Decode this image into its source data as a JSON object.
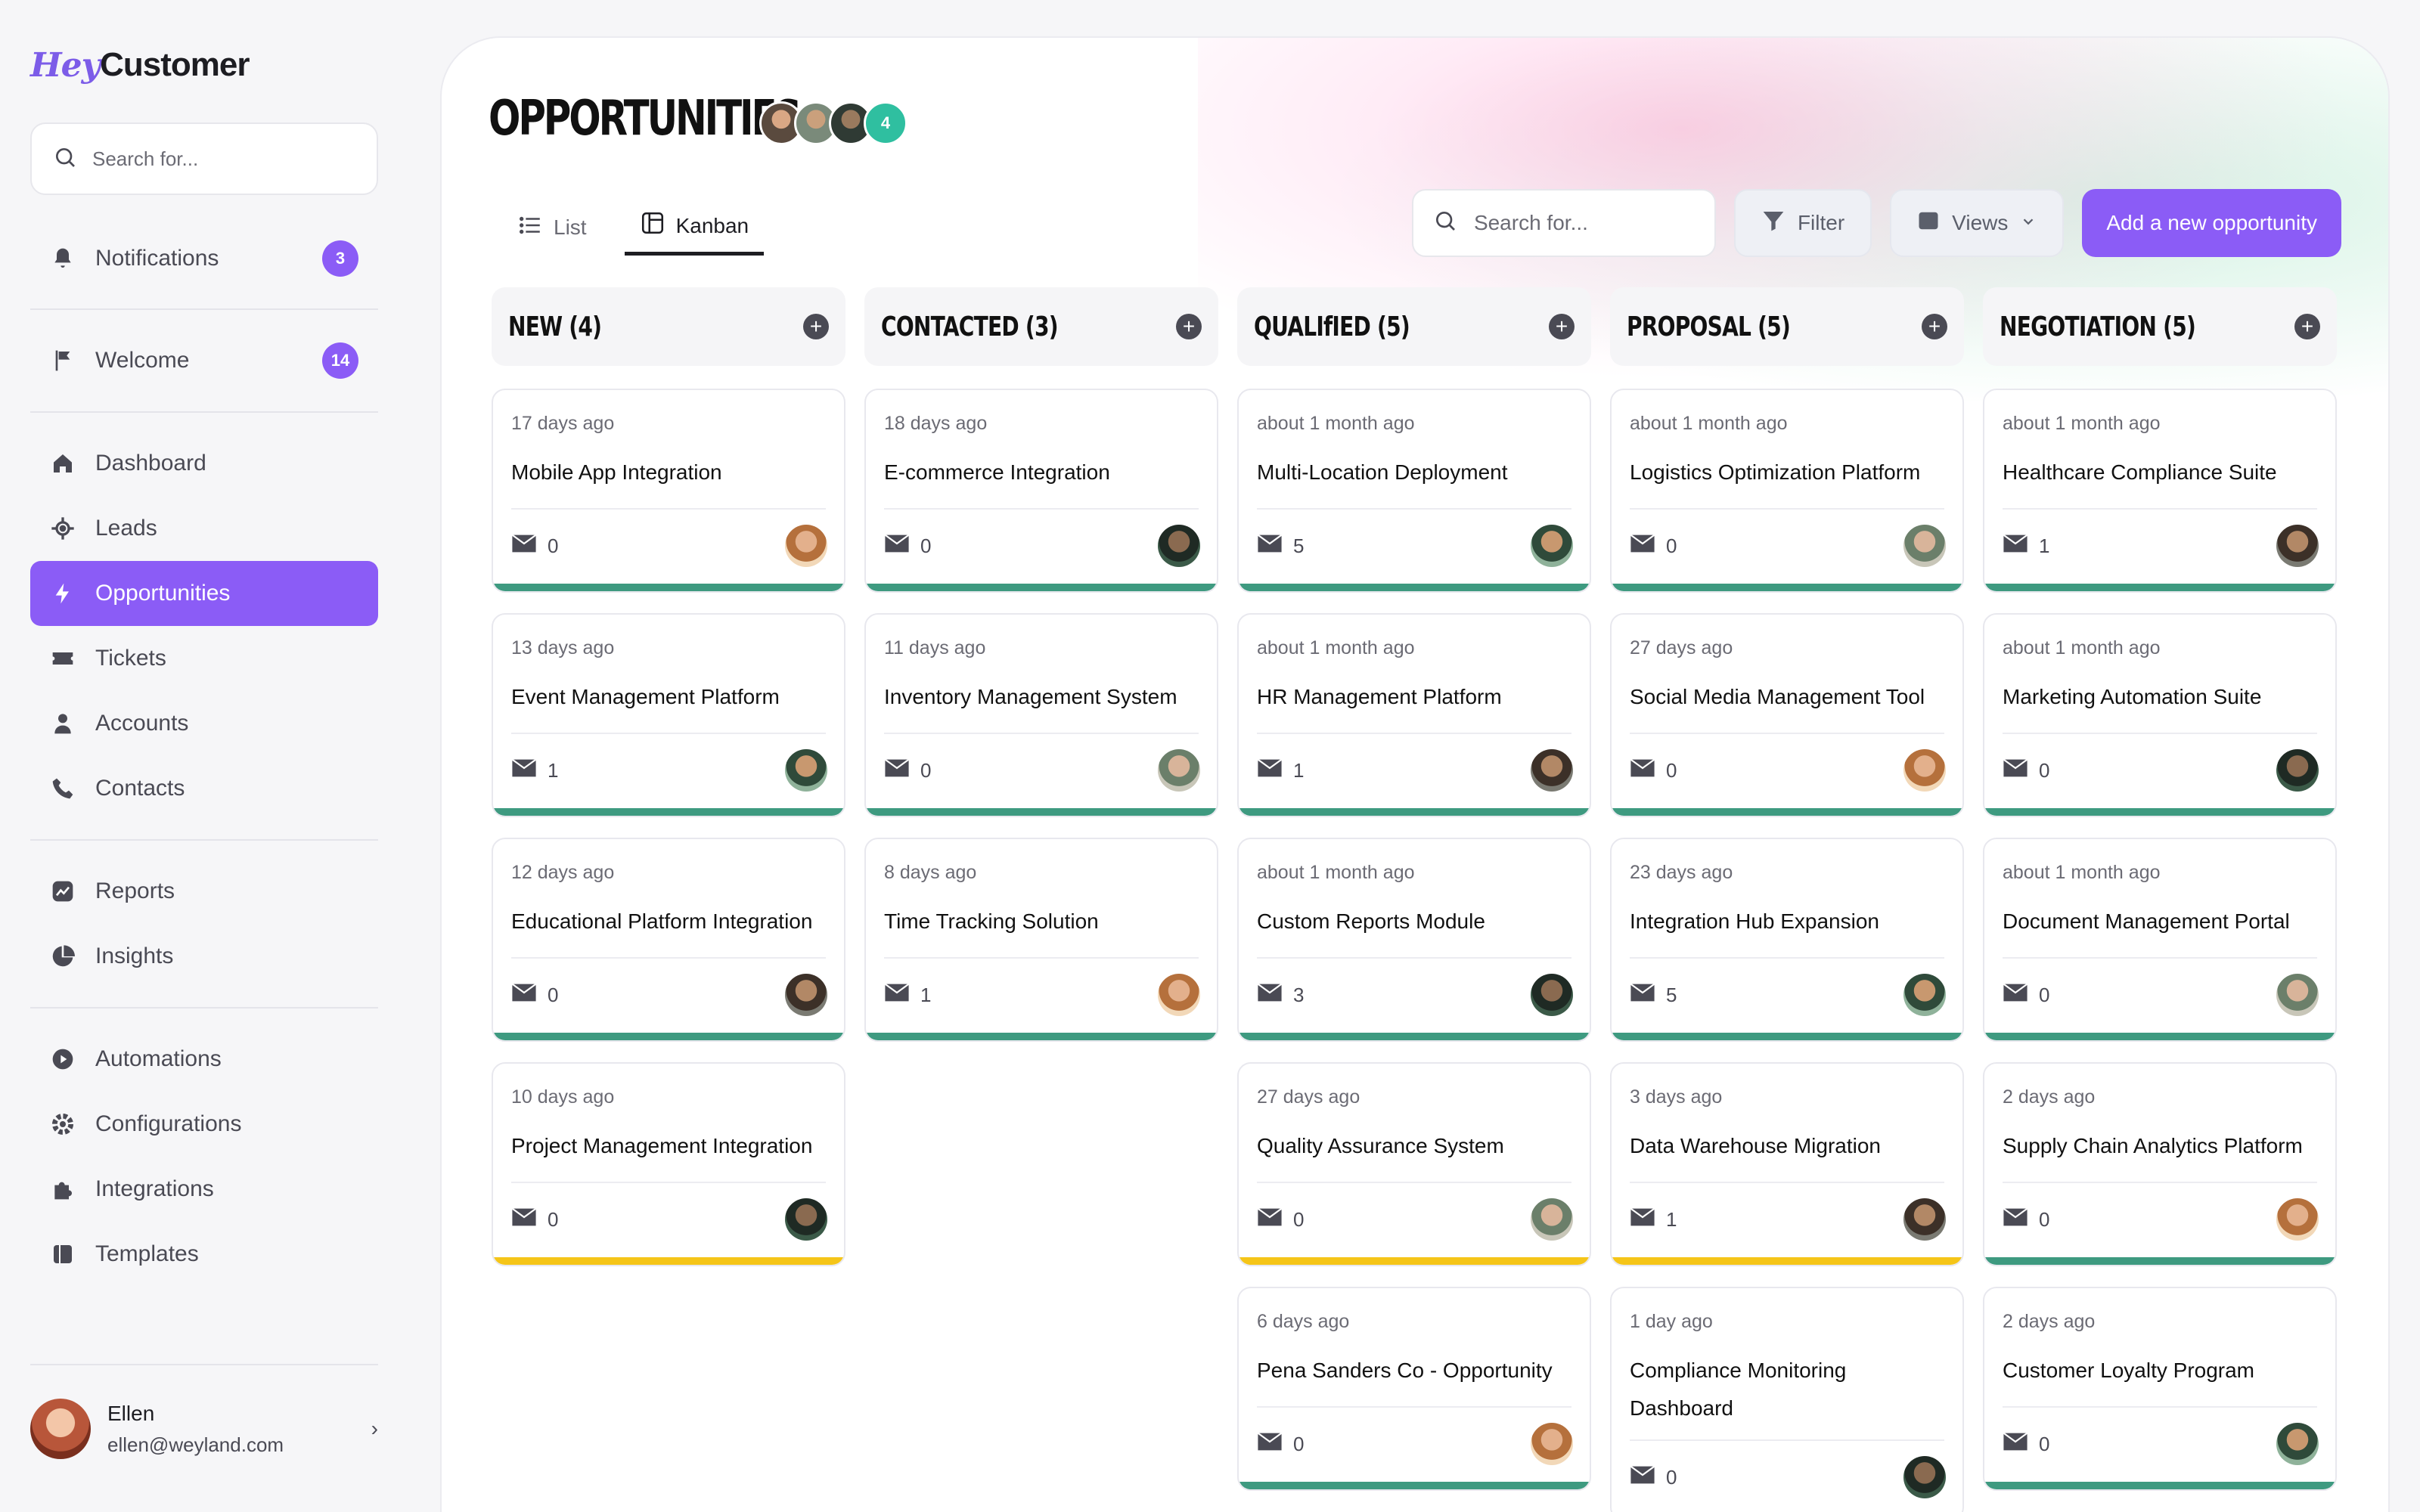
{
  "app": {
    "logo_hey": "Hey",
    "logo_customer": "Customer",
    "search_placeholder": "Search for..."
  },
  "sidebar": {
    "items": [
      {
        "label": "Notifications",
        "icon": "bell-icon",
        "badge": "3"
      },
      {
        "label": "Welcome",
        "icon": "flag-icon",
        "badge": "14"
      },
      {
        "label": "Dashboard",
        "icon": "home-icon"
      },
      {
        "label": "Leads",
        "icon": "target-icon"
      },
      {
        "label": "Opportunities",
        "icon": "bolt-icon",
        "active": true
      },
      {
        "label": "Tickets",
        "icon": "ticket-icon"
      },
      {
        "label": "Accounts",
        "icon": "user-icon"
      },
      {
        "label": "Contacts",
        "icon": "phone-icon"
      },
      {
        "label": "Reports",
        "icon": "chart-icon"
      },
      {
        "label": "Insights",
        "icon": "pie-icon"
      },
      {
        "label": "Automations",
        "icon": "play-icon"
      },
      {
        "label": "Configurations",
        "icon": "gear-icon"
      },
      {
        "label": "Integrations",
        "icon": "puzzle-icon"
      },
      {
        "label": "Templates",
        "icon": "template-icon"
      }
    ],
    "user": {
      "name": "Ellen",
      "email": "ellen@weyland.com"
    }
  },
  "header": {
    "title": "OPPORTUNITIES",
    "members_extra": "4",
    "tabs": [
      {
        "label": "List",
        "icon": "list-icon"
      },
      {
        "label": "Kanban",
        "icon": "kanban-icon",
        "active": true
      }
    ],
    "search_placeholder": "Search for...",
    "filter_label": "Filter",
    "views_label": "Views",
    "add_label": "Add a new opportunity"
  },
  "colors": {
    "accent": "#8b5cf6",
    "bar_green": "#3e9a80",
    "bar_yellow": "#f5c518",
    "members_badge": "#2fbfa0"
  },
  "board": {
    "columns": [
      {
        "title": "NEW (4)",
        "cards": [
          {
            "ago": "17 days ago",
            "name": "Mobile App Integration",
            "messages": "0",
            "bar": "green"
          },
          {
            "ago": "13 days ago",
            "name": "Event Management Platform",
            "messages": "1",
            "bar": "green"
          },
          {
            "ago": "12 days ago",
            "name": "Educational Platform Integration",
            "messages": "0",
            "bar": "green"
          },
          {
            "ago": "10 days ago",
            "name": "Project Management Integration",
            "messages": "0",
            "bar": "yellow"
          }
        ]
      },
      {
        "title": "CONTACTED (3)",
        "cards": [
          {
            "ago": "18 days ago",
            "name": "E-commerce Integration",
            "messages": "0",
            "bar": "green"
          },
          {
            "ago": "11 days ago",
            "name": "Inventory Management System",
            "messages": "0",
            "bar": "green"
          },
          {
            "ago": "8 days ago",
            "name": "Time Tracking Solution",
            "messages": "1",
            "bar": "green"
          }
        ]
      },
      {
        "title": "QUALIfIED (5)",
        "cards": [
          {
            "ago": "about 1 month ago",
            "name": "Multi-Location Deployment",
            "messages": "5",
            "bar": "green"
          },
          {
            "ago": "about 1 month ago",
            "name": "HR Management Platform",
            "messages": "1",
            "bar": "green"
          },
          {
            "ago": "about 1 month ago",
            "name": "Custom Reports Module",
            "messages": "3",
            "bar": "green"
          },
          {
            "ago": "27 days ago",
            "name": "Quality Assurance System",
            "messages": "0",
            "bar": "yellow"
          },
          {
            "ago": "6 days ago",
            "name": "Pena Sanders Co - Opportunity",
            "messages": "0",
            "bar": "green"
          }
        ]
      },
      {
        "title": "PROPOSAL (5)",
        "cards": [
          {
            "ago": "about 1 month ago",
            "name": "Logistics Optimization Platform",
            "messages": "0",
            "bar": "green"
          },
          {
            "ago": "27 days ago",
            "name": "Social Media Management Tool",
            "messages": "0",
            "bar": "green"
          },
          {
            "ago": "23 days ago",
            "name": "Integration Hub Expansion",
            "messages": "5",
            "bar": "green"
          },
          {
            "ago": "3 days ago",
            "name": "Data Warehouse Migration",
            "messages": "1",
            "bar": "yellow"
          },
          {
            "ago": "1 day ago",
            "name": "Compliance Monitoring Dashboard",
            "messages": "0",
            "bar": "green"
          }
        ]
      },
      {
        "title": "NEGOTIATION (5)",
        "cards": [
          {
            "ago": "about 1 month ago",
            "name": "Healthcare Compliance Suite",
            "messages": "1",
            "bar": "green"
          },
          {
            "ago": "about 1 month ago",
            "name": "Marketing Automation Suite",
            "messages": "0",
            "bar": "green"
          },
          {
            "ago": "about 1 month ago",
            "name": "Document Management Portal",
            "messages": "0",
            "bar": "green"
          },
          {
            "ago": "2 days ago",
            "name": "Supply Chain Analytics Platform",
            "messages": "0",
            "bar": "green"
          },
          {
            "ago": "2 days ago",
            "name": "Customer Loyalty Program",
            "messages": "0",
            "bar": "green"
          }
        ]
      }
    ]
  }
}
